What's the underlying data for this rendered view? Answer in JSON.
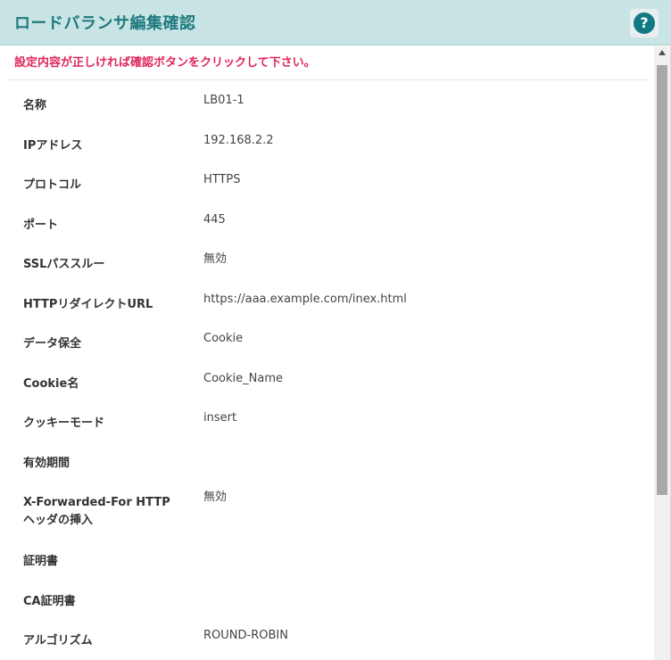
{
  "dialog": {
    "title": "ロードバランサ編集確認",
    "help_label": "?"
  },
  "notice": "設定内容が正しければ確認ボタンをクリックして下さい。",
  "fields": [
    {
      "label": "名称",
      "value": "LB01-1"
    },
    {
      "label": "IPアドレス",
      "value": "192.168.2.2"
    },
    {
      "label": "プロトコル",
      "value": "HTTPS"
    },
    {
      "label": "ポート",
      "value": "445"
    },
    {
      "label": "SSLパススルー",
      "value": "無効"
    },
    {
      "label": "HTTPリダイレクトURL",
      "value": "https://aaa.example.com/inex.html"
    },
    {
      "label": "データ保全",
      "value": "Cookie"
    },
    {
      "label": "Cookie名",
      "value": "Cookie_Name"
    },
    {
      "label": "クッキーモード",
      "value": "insert"
    },
    {
      "label": "有効期間",
      "value": ""
    },
    {
      "label": "X-Forwarded-For HTTPヘッダの挿入",
      "value": "無効"
    },
    {
      "label": "証明書",
      "value": ""
    },
    {
      "label": "CA証明書",
      "value": ""
    },
    {
      "label": "アルゴリズム",
      "value": "ROUND-ROBIN"
    }
  ],
  "colors": {
    "header_bg": "#c8e4e4",
    "title": "#1f7a80",
    "notice": "#e0265a",
    "help_icon": "#127a85"
  }
}
